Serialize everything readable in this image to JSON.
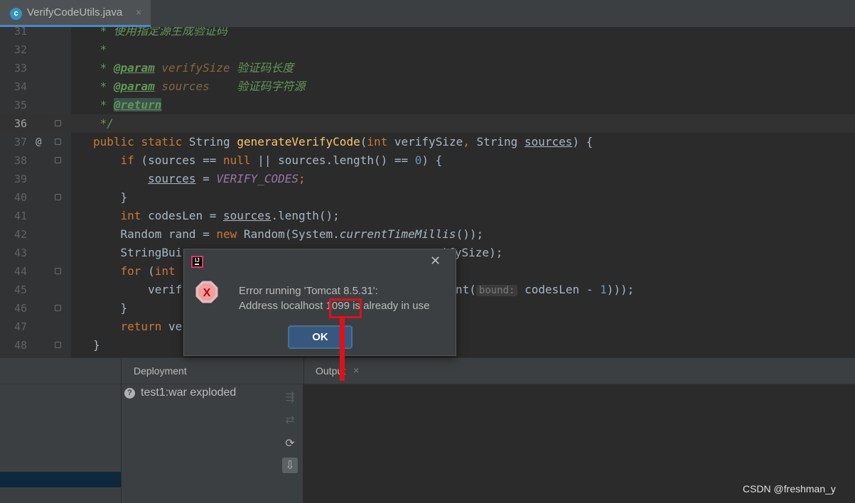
{
  "tab": {
    "icon": "c-class-icon",
    "icon_letter": "c",
    "name": "VerifyCodeUtils.java",
    "close": "×"
  },
  "lines": [
    {
      "num": "31",
      "current": false,
      "marker": "",
      "fold": false
    },
    {
      "num": "32",
      "current": false,
      "marker": "",
      "fold": false
    },
    {
      "num": "33",
      "current": false,
      "marker": "",
      "fold": false
    },
    {
      "num": "34",
      "current": false,
      "marker": "",
      "fold": false
    },
    {
      "num": "35",
      "current": false,
      "marker": "",
      "fold": false
    },
    {
      "num": "36",
      "current": true,
      "marker": "",
      "fold": true
    },
    {
      "num": "37",
      "current": false,
      "marker": "@",
      "fold": true
    },
    {
      "num": "38",
      "current": false,
      "marker": "",
      "fold": true
    },
    {
      "num": "39",
      "current": false,
      "marker": "",
      "fold": false
    },
    {
      "num": "40",
      "current": false,
      "marker": "",
      "fold": true
    },
    {
      "num": "41",
      "current": false,
      "marker": "",
      "fold": false
    },
    {
      "num": "42",
      "current": false,
      "marker": "",
      "fold": false
    },
    {
      "num": "43",
      "current": false,
      "marker": "",
      "fold": false
    },
    {
      "num": "44",
      "current": false,
      "marker": "",
      "fold": true
    },
    {
      "num": "45",
      "current": false,
      "marker": "",
      "fold": false
    },
    {
      "num": "46",
      "current": false,
      "marker": "",
      "fold": true
    },
    {
      "num": "47",
      "current": false,
      "marker": "",
      "fold": false
    },
    {
      "num": "48",
      "current": false,
      "marker": "",
      "fold": true
    }
  ],
  "code": {
    "l31": {
      "star": " * ",
      "text": "使用指定源生成验证码"
    },
    "l32": {
      "star": " *"
    },
    "l33": {
      "star": " * ",
      "tag": "@param",
      "param": "verifySize",
      "desc": " 验证码长度"
    },
    "l34": {
      "star": " * ",
      "tag": "@param",
      "param": "sources",
      "desc": "    验证码字符源"
    },
    "l35": {
      "star": " * ",
      "tag": "@return"
    },
    "l36": {
      "end": " */"
    },
    "l37": {
      "kw1": "public",
      "kw2": "static",
      "type": "String",
      "fn": "generateVerifyCode",
      "open": "(",
      "kw3": "int",
      "p1": "verifySize",
      "comma": ",",
      "type2": "String",
      "p2": "sources",
      "close": ") {"
    },
    "l38": {
      "kw": "if",
      "a": " (sources == ",
      "null": "null",
      "b": " || sources.length() == ",
      "num": "0",
      "c": ") {"
    },
    "l39": {
      "var": "sources",
      "eq": " = ",
      "const": "VERIFY_CODES",
      "semi": ";"
    },
    "l40": {
      "brace": "}"
    },
    "l41": {
      "kw": "int",
      "a": " codesLen = ",
      "var": "sources",
      "b": ".length();"
    },
    "l42": {
      "a": "Random rand = ",
      "kw": "new",
      "b": " Random(System.",
      "it": "currentTimeMillis",
      "c": "());"
    },
    "l43": {
      "a": "StringBui",
      "b": "rifySize);"
    },
    "l44": {
      "kw": "for",
      "a": " (",
      "kw2": "int"
    },
    "l45": {
      "a": "verif",
      "b": "nt(",
      "hint": "bound:",
      "c": " codesLen - ",
      "num": "1",
      "d": ")));"
    },
    "l46": {
      "brace": "}"
    },
    "l47": {
      "kw": "return",
      "a": " ve"
    },
    "l48": {
      "brace": "}"
    }
  },
  "dialog": {
    "logo": "intellij-logo",
    "logo_letter": "IJ",
    "close": "✕",
    "icon": "error-icon",
    "icon_letter": "X",
    "line1": "Error running 'Tomcat 8.5.31':",
    "line2": "Address localhost 1099 is already in use",
    "ok_label": "OK"
  },
  "panel": {
    "deployment_label": "Deployment",
    "output_label": "Output",
    "output_close": "×",
    "deploy_item_icon": "question-icon",
    "deploy_item_icon_glyph": "?",
    "deploy_item": "test1:war exploded",
    "tools": [
      {
        "name": "deploy-all-icon",
        "glyph": "⇶"
      },
      {
        "name": "undeploy-icon",
        "glyph": "⇄"
      },
      {
        "name": "refresh-icon",
        "glyph": "⟳"
      },
      {
        "name": "deploy-down-icon",
        "glyph": "⇩"
      }
    ]
  },
  "watermark": "CSDN @freshman_y",
  "colors": {
    "annotation": "#e0101a",
    "accent": "#365880"
  }
}
